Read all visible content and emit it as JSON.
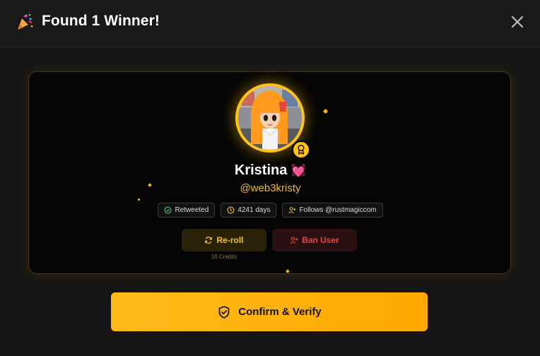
{
  "header": {
    "title": "Found 1 Winner!",
    "icon": "party-popper-icon",
    "close_icon": "close-icon"
  },
  "winner": {
    "name": "Kristina",
    "name_emoji": "💓",
    "handle": "@web3kristy",
    "badge_icon": "award-icon",
    "chips": [
      {
        "icon": "check-circle-icon",
        "label": "Retweeted",
        "color": "#3ecf6a"
      },
      {
        "icon": "clock-icon",
        "label": "4241 days",
        "color": "#f5c030"
      },
      {
        "icon": "user-plus-icon",
        "label": "Follows @rustmagiccom",
        "color": "#f5c030"
      }
    ]
  },
  "actions": {
    "reroll_label": "Re-roll",
    "reroll_icon": "refresh-icon",
    "ban_label": "Ban User",
    "ban_icon": "user-x-icon",
    "credits_label": "10 Credits"
  },
  "confirm": {
    "label": "Confirm & Verify",
    "icon": "shield-check-icon"
  },
  "colors": {
    "accent": "#ffb400",
    "danger": "#e04848",
    "success": "#3ecf6a"
  }
}
